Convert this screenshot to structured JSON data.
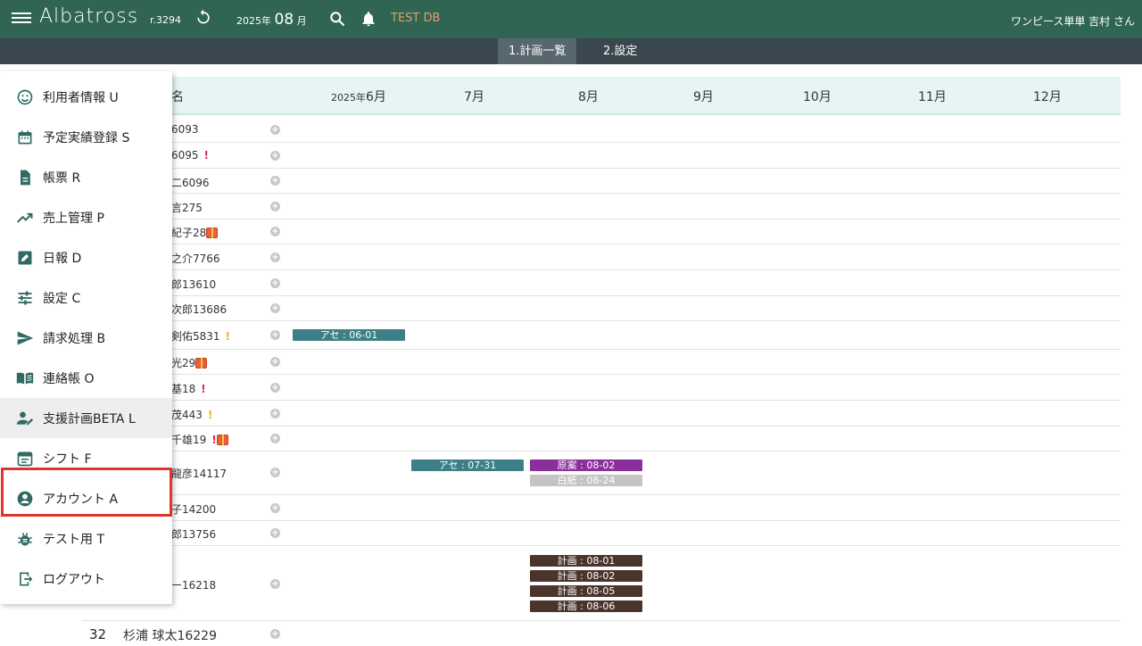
{
  "header": {
    "brand": "Albatross",
    "revision": "r.3294",
    "year_label": "2025年",
    "month_value": "08",
    "month_suffix": "月",
    "db_label": "TEST DB",
    "user_label": "ワンピース単単 吉村 さん"
  },
  "subtabs": [
    "1.計画一覧",
    "2.設定"
  ],
  "table": {
    "name_header": "名",
    "months": [
      "2025年6月",
      "7月",
      "8月",
      "9月",
      "10月",
      "11月",
      "12月"
    ],
    "rows": [
      {
        "name": "6093"
      },
      {
        "name": "6095",
        "flag": "!"
      },
      {
        "name": "二6096"
      },
      {
        "name": "言275"
      },
      {
        "name": "紀子28"
      },
      {
        "name": "之介7766"
      },
      {
        "name": "郎13610"
      },
      {
        "name": "次郎13686"
      },
      {
        "name": "剣佑5831",
        "flag": "!"
      },
      {
        "name": "光29"
      },
      {
        "name": "基18",
        "flag": "!"
      },
      {
        "name": "茂443",
        "flag": "!"
      },
      {
        "name": "千雄19",
        "flag": "!"
      },
      {
        "name": "龍彦14117"
      },
      {
        "name": "子14200"
      },
      {
        "name": "郎13756"
      },
      {
        "name": "ー16218"
      },
      {
        "number": "32",
        "name": "杉浦 球太16229"
      }
    ],
    "chips": {
      "r9": [
        "アセ : 06-01"
      ],
      "r14a": "アセ : 07-31",
      "r14b": "原案 : 08-02",
      "r14c": "白紙 : 08-24",
      "r17": [
        "計画 : 08-01",
        "計画 : 08-02",
        "計画 : 08-05",
        "計画 : 08-06"
      ]
    }
  },
  "menu": {
    "items": [
      {
        "label": "利用者情報 U",
        "icon": "smiley-icon"
      },
      {
        "label": "予定実績登録 S",
        "icon": "calendar-icon"
      },
      {
        "label": "帳票 R",
        "icon": "document-icon"
      },
      {
        "label": "売上管理 P",
        "icon": "trending-up-icon"
      },
      {
        "label": "日報 D",
        "icon": "edit-note-icon"
      },
      {
        "label": "設定 C",
        "icon": "tune-icon"
      },
      {
        "label": "請求処理 B",
        "icon": "send-icon"
      },
      {
        "label": "連絡帳 O",
        "icon": "book-icon"
      },
      {
        "label": "支援計画BETA L",
        "icon": "person-edit-icon"
      },
      {
        "label": "シフト F",
        "icon": "event-note-icon"
      },
      {
        "label": "アカウント A",
        "icon": "account-circle-icon"
      },
      {
        "label": "テスト用 T",
        "icon": "bug-icon"
      },
      {
        "label": "ログアウト",
        "icon": "logout-icon"
      }
    ]
  },
  "colors": {
    "topbar": "#2f6552",
    "subbar": "#3b474f",
    "chip_teal": "#3d7f86",
    "chip_purple": "#8a2f9c",
    "chip_gray": "#c4c4c4",
    "chip_brown": "#4a342c",
    "highlight": "#e0342c"
  }
}
